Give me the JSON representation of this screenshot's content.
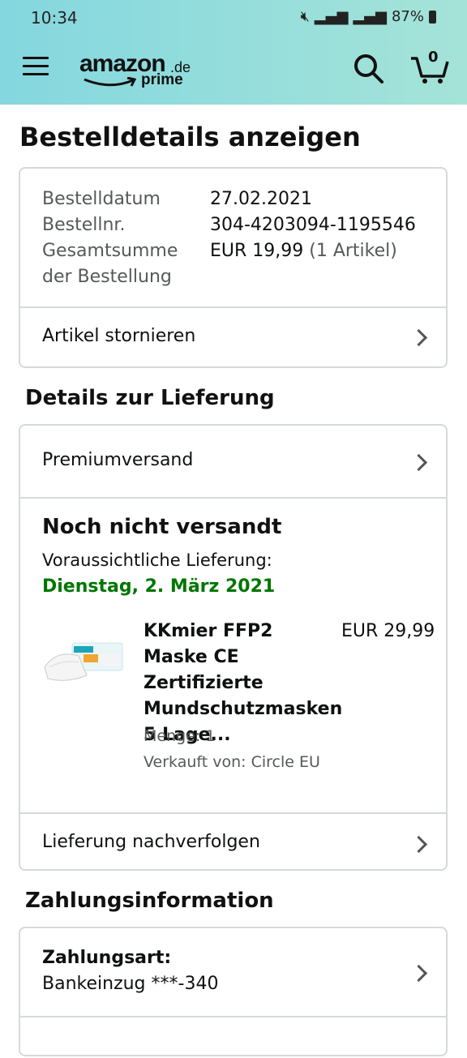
{
  "status_bar": {
    "time": "10:34",
    "battery": "87%"
  },
  "header": {
    "logo_main": "amazon",
    "logo_domain": ".de",
    "logo_sub": "prime",
    "cart_count": "0"
  },
  "page_title": "Bestelldetails anzeigen",
  "order": {
    "date_label": "Bestelldatum",
    "date_value": "27.02.2021",
    "number_label": "Bestellnr.",
    "number_value": "304-4203094-1195546",
    "total_label_1": "Gesamtsumme",
    "total_label_2": "der Bestellung",
    "total_value": "EUR 19,99",
    "total_items": "(1 Artikel)",
    "cancel_label": "Artikel stornieren"
  },
  "delivery": {
    "section_title": "Details zur Lieferung",
    "shipping_method": "Premiumversand",
    "status_title": "Noch nicht versandt",
    "expected_label": "Voraussichtliche Lieferung:",
    "expected_date": "Dienstag, 2. März 2021",
    "product": {
      "title": "KKmier FFP2 Maske CE Zertifizierte Mundschutzmasken 5 Lage...",
      "price": "EUR 29,99",
      "quantity": "Menge: 1",
      "seller": "Verkauft von: Circle EU"
    },
    "track_label": "Lieferung nachverfolgen"
  },
  "payment": {
    "section_title": "Zahlungsinformation",
    "method_label": "Zahlungsart:",
    "method_value": "Bankeinzug ***-340"
  },
  "colors": {
    "header_gradient_start": "#84d7df",
    "header_gradient_end": "#a5e3d8",
    "delivery_green": "#007600",
    "border": "#d5d9d9"
  }
}
